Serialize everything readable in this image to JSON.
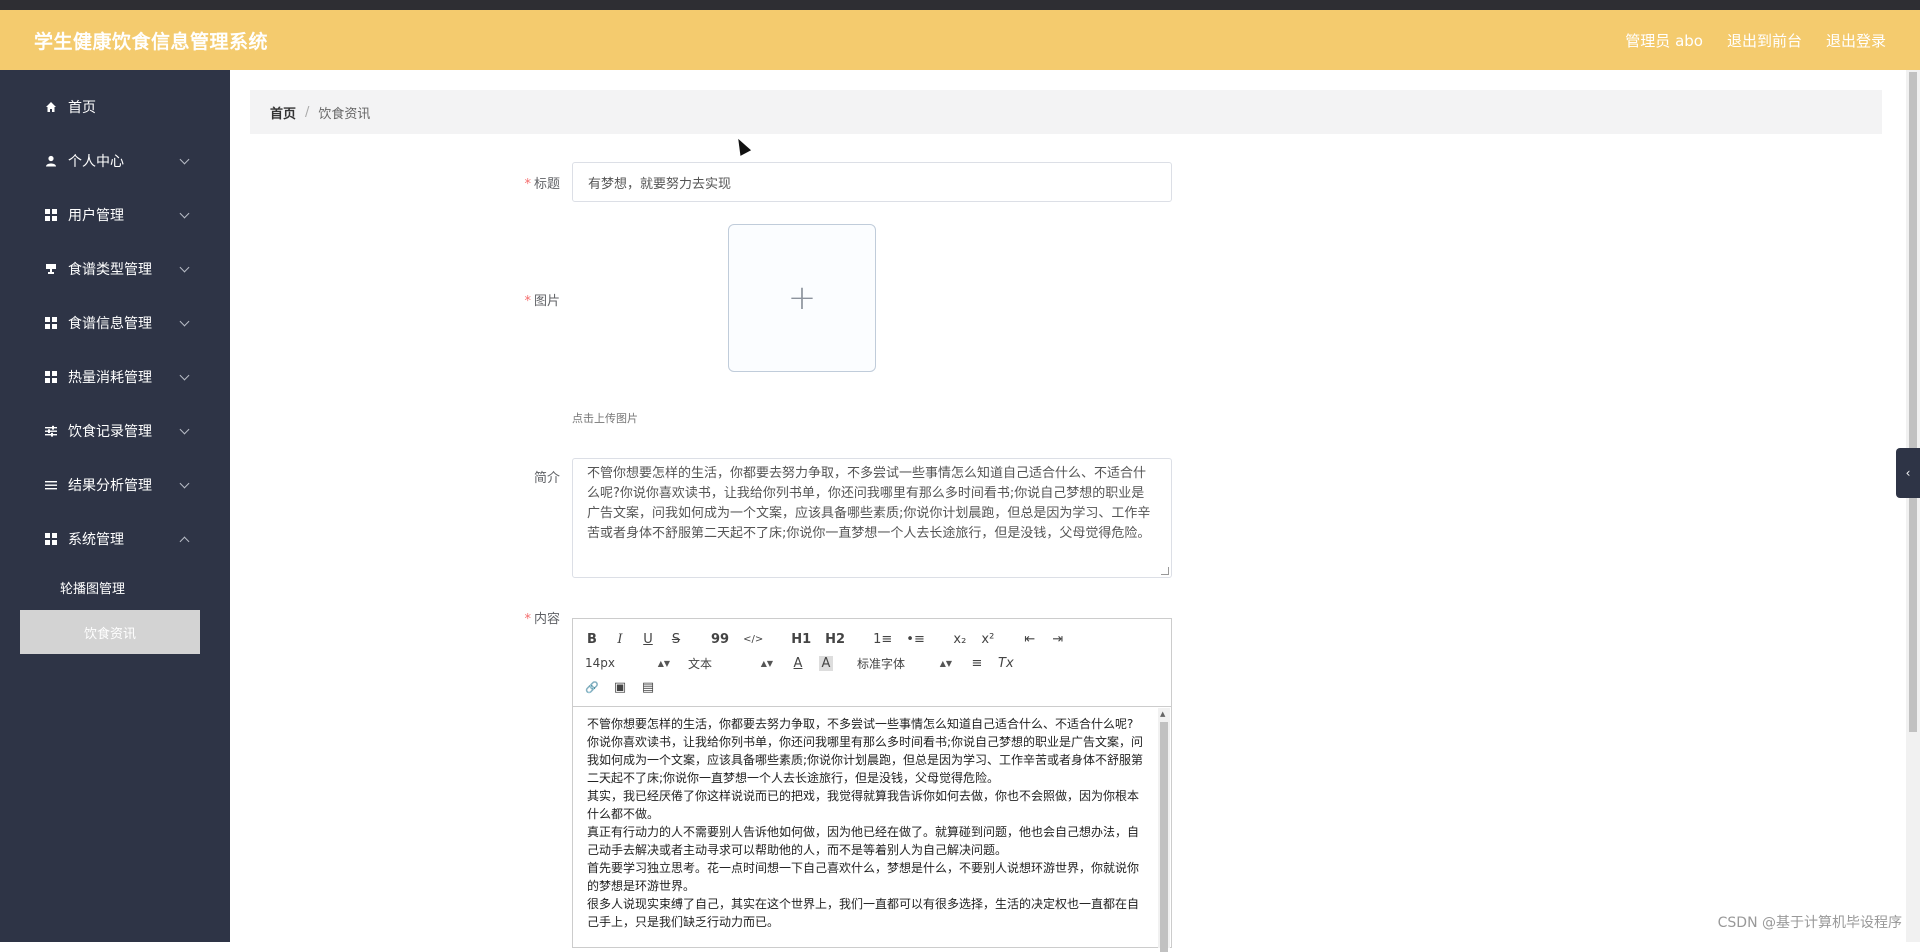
{
  "header": {
    "title": "学生健康饮食信息管理系统",
    "admin": "管理员 abo",
    "to_front": "退出到前台",
    "logout": "退出登录"
  },
  "sidebar": {
    "items": [
      {
        "label": "首页",
        "icon": "home-icon"
      },
      {
        "label": "个人中心",
        "icon": "user-icon"
      },
      {
        "label": "用户管理",
        "icon": "grid-icon"
      },
      {
        "label": "食谱类型管理",
        "icon": "stamp-icon"
      },
      {
        "label": "食谱信息管理",
        "icon": "grid-icon"
      },
      {
        "label": "热量消耗管理",
        "icon": "grid-icon"
      },
      {
        "label": "饮食记录管理",
        "icon": "sliders-icon"
      },
      {
        "label": "结果分析管理",
        "icon": "list-icon"
      },
      {
        "label": "系统管理",
        "icon": "grid-icon"
      }
    ],
    "sub_items": [
      "轮播图管理",
      "饮食资讯"
    ]
  },
  "breadcrumb": {
    "home": "首页",
    "sep": "/",
    "current": "饮食资讯"
  },
  "form": {
    "title_label": "标题",
    "title_value": "有梦想，就要努力去实现",
    "image_label": "图片",
    "upload_plus": "+",
    "upload_tip": "点击上传图片",
    "intro_label": "简介",
    "intro_value": "不管你想要怎样的生活，你都要去努力争取，不多尝试一些事情怎么知道自己适合什么、不适合什么呢?你说你喜欢读书，让我给你列书单，你还问我哪里有那么多时间看书;你说自己梦想的职业是广告文案，问我如何成为一个文案，应该具备哪些素质;你说你计划晨跑，但总是因为学习、工作辛苦或者身体不舒服第二天起不了床;你说你一直梦想一个人去长途旅行，但是没钱，父母觉得危险。",
    "content_label": "内容",
    "required_mark": "*"
  },
  "editor": {
    "toolbar": {
      "bold": "B",
      "italic": "I",
      "underline": "U",
      "strike": "S",
      "quote": "99",
      "code": "</>",
      "h1": "H1",
      "h2": "H2",
      "ordered_list": "1≡",
      "bullet_list": "•≡",
      "subscript": "x₂",
      "superscript": "x²",
      "outdent": "⇤",
      "indent": "⇥",
      "size": "14px",
      "header": "文本",
      "color": "A",
      "background": "A",
      "font": "标准字体",
      "align": "≡",
      "clean": "Tx",
      "link": "🔗",
      "image": "▣",
      "video": "▤"
    },
    "paragraphs": [
      "不管你想要怎样的生活，你都要去努力争取，不多尝试一些事情怎么知道自己适合什么、不适合什么呢?",
      "你说你喜欢读书，让我给你列书单，你还问我哪里有那么多时间看书;你说自己梦想的职业是广告文案，问我如何成为一个文案，应该具备哪些素质;你说你计划晨跑，但总是因为学习、工作辛苦或者身体不舒服第二天起不了床;你说你一直梦想一个人去长途旅行，但是没钱，父母觉得危险。",
      "其实，我已经厌倦了你这样说说而已的把戏，我觉得就算我告诉你如何去做，你也不会照做，因为你根本什么都不做。",
      "真正有行动力的人不需要别人告诉他如何做，因为他已经在做了。就算碰到问题，他也会自己想办法，自己动手去解决或者主动寻求可以帮助他的人，而不是等着别人为自己解决问题。",
      "首先要学习独立思考。花一点时间想一下自己喜欢什么，梦想是什么，不要别人说想环游世界，你就说你的梦想是环游世界。",
      "很多人说现实束缚了自己，其实在这个世界上，我们一直都可以有很多选择，生活的决定权也一直都在自己手上，只是我们缺乏行动力而已。"
    ]
  },
  "drawer_tab": "‹",
  "watermark": "CSDN @基于计算机毕设程序"
}
